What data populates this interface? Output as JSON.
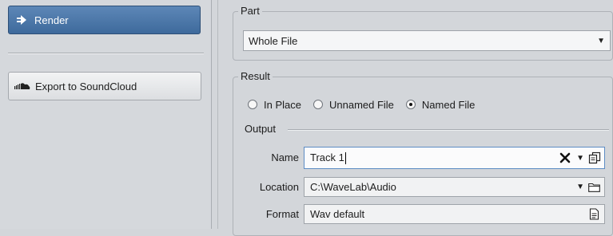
{
  "sidebar": {
    "render_label": "Render",
    "soundcloud_label": "Export to SoundCloud"
  },
  "part": {
    "legend": "Part",
    "selected": "Whole File"
  },
  "result": {
    "legend": "Result",
    "options": [
      {
        "label": "In Place",
        "checked": false
      },
      {
        "label": "Unnamed File",
        "checked": false
      },
      {
        "label": "Named File",
        "checked": true
      }
    ]
  },
  "output": {
    "legend": "Output",
    "name_label": "Name",
    "name_value": "Track 1",
    "location_label": "Location",
    "location_value": "C:\\WaveLab\\Audio",
    "format_label": "Format",
    "format_value": "Wav default"
  },
  "icons": {
    "render": "render-arrow-icon",
    "soundcloud": "soundcloud-icon",
    "clear": "clear-x-icon",
    "dropdown": "chevron-down-icon",
    "copy": "copy-icon",
    "folder": "folder-icon",
    "preset": "preset-icon"
  },
  "colors": {
    "accent": "#4a76a8",
    "background": "#d3d6da",
    "field_focus_border": "#5d8cc4"
  }
}
